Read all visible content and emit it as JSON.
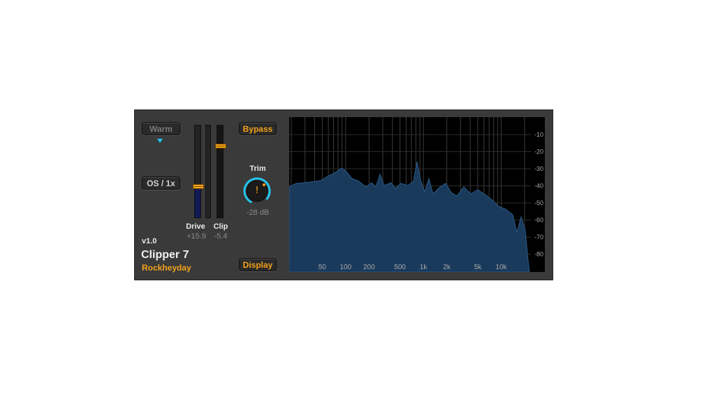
{
  "plugin": {
    "version": "v1.0",
    "name": "Clipper 7",
    "vendor": "Rockheyday",
    "colors": {
      "accent": "#f3a21a",
      "background": "#3a3a3a",
      "spectrum_fill": "#1a3a5c",
      "indicator": "#22c6f0"
    }
  },
  "buttons": {
    "warm": "Warm",
    "oversampling": "OS / 1x",
    "bypass": "Bypass",
    "display": "Display"
  },
  "faders": {
    "drive": {
      "label": "Drive",
      "value": "+15.9",
      "level": 0.34
    },
    "clip": {
      "label": "Clip",
      "value": "-5.4",
      "level": 0.78
    }
  },
  "trim": {
    "label": "Trim",
    "value": "-28 dB",
    "icon": "exclamation-icon"
  },
  "spectrum": {
    "freq_labels": [
      "50",
      "100",
      "200",
      "500",
      "1k",
      "2k",
      "5k",
      "10k"
    ],
    "db_labels": [
      "-10",
      "-20",
      "-30",
      "-40",
      "-50",
      "-60",
      "-70",
      "-80"
    ]
  }
}
